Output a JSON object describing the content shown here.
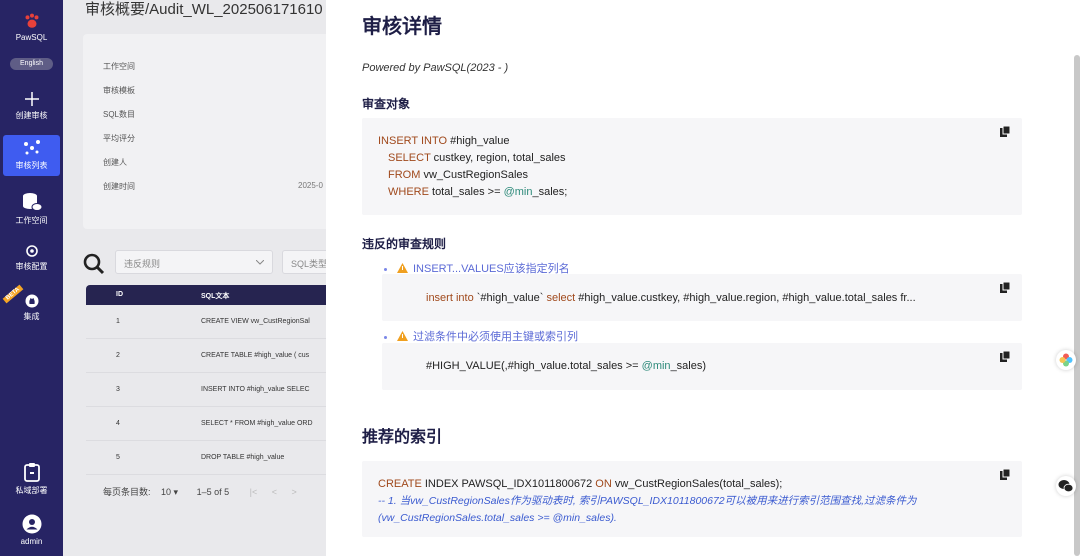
{
  "sidebar": {
    "brand": "PawSQL",
    "lang_button": "English",
    "items": [
      {
        "label": "创建审核",
        "icon": "plus-icon"
      },
      {
        "label": "审核列表",
        "icon": "audit-list-icon"
      },
      {
        "label": "工作空间",
        "icon": "database-icon"
      },
      {
        "label": "审核配置",
        "icon": "gear-icon"
      },
      {
        "label": "集成",
        "icon": "github-icon"
      },
      {
        "label": "私域部署",
        "icon": "clipboard-icon"
      },
      {
        "label": "admin",
        "icon": "user-avatar-icon"
      }
    ],
    "beta_badge": "BETA",
    "active_color": "#3f5cf0"
  },
  "main": {
    "page_title": "审核概要/Audit_WL_202506171610",
    "info": [
      {
        "label": "工作空间",
        "value": ""
      },
      {
        "label": "审核模板",
        "value": ""
      },
      {
        "label": "SQL数目",
        "value": ""
      },
      {
        "label": "平均评分",
        "value": ""
      },
      {
        "label": "创建人",
        "value": ""
      },
      {
        "label": "创建时间",
        "value": "2025-0"
      }
    ],
    "filters": {
      "rule_placeholder": "违反规则",
      "sql_type_placeholder": "SQL类型"
    },
    "table": {
      "headers": [
        "ID",
        "SQL文本"
      ],
      "rows": [
        {
          "id": "1",
          "sql": "CREATE VIEW vw_CustRegionSal"
        },
        {
          "id": "2",
          "sql": "CREATE TABLE #high_value ( cus"
        },
        {
          "id": "3",
          "sql": "INSERT INTO #high_value SELEC"
        },
        {
          "id": "4",
          "sql": "SELECT * FROM #high_value ORD"
        },
        {
          "id": "5",
          "sql": "DROP TABLE #high_value"
        }
      ]
    },
    "pager": {
      "rows_per_page_label": "每页条目数:",
      "rows_per_page": "10",
      "range": "1–5 of 5"
    }
  },
  "detail": {
    "title": "审核详情",
    "powered": "Powered by PawSQL(2023 - )",
    "audit_target_heading": "审查对象",
    "audit_sql": {
      "l1_kw": "INSERT INTO",
      "l1_rest": " #high_value",
      "l2_kw": "SELECT",
      "l2_rest": " custkey, region, total_sales",
      "l3_kw": "FROM",
      "l3_rest": " vw_CustRegionSales",
      "l4_kw": "WHERE",
      "l4_rest": " total_sales >= ",
      "l4_var": "@min",
      "l4_end": "_sales;"
    },
    "violations_heading": "违反的审查规则",
    "rules": [
      {
        "name": "INSERT...VALUES应该指定列名",
        "code_kw1": "insert into",
        "code_mid": " `#high_value` ",
        "code_kw2": "select",
        "code_rest": " #high_value.custkey, #high_value.region, #high_value.total_sales fr..."
      },
      {
        "name": "过滤条件中必须使用主键或索引列",
        "code_pre": "#HIGH_VALUE(,#high_value.total_sales >= ",
        "code_var": "@min",
        "code_end": "_sales)"
      }
    ],
    "index_heading": "推荐的索引",
    "index": {
      "kw1": "CREATE",
      "mid1": " INDEX PAWSQL_IDX1011800672 ",
      "kw2": "ON",
      "rest": " vw_CustRegionSales(total_sales);",
      "comment": "-- 1. 当vw_CustRegionSales作为驱动表时, 索引PAWSQL_IDX1011800672可以被用来进行索引范围查找,过滤条件为(vw_CustRegionSales.total_sales >= @min_sales)."
    }
  }
}
